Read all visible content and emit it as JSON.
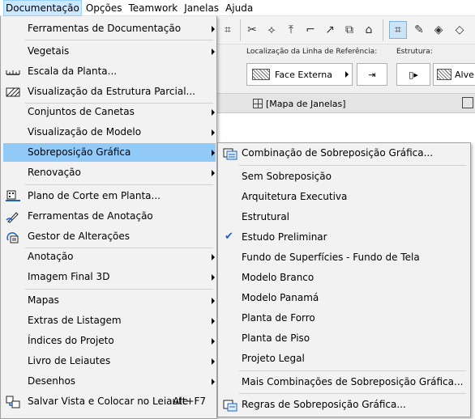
{
  "menubar": {
    "items": [
      "Documentação",
      "Opções",
      "Teamwork",
      "Janelas",
      "Ajuda"
    ]
  },
  "infobox": {
    "ref_line_label": "Localização da Linha de Referência:",
    "ref_line_value": "Face Externa",
    "structure_label": "Estrutura:",
    "structure_value": "Alve"
  },
  "tab": {
    "label": "[Mapa de Janelas]"
  },
  "main_menu": {
    "items": [
      {
        "label": "Ferramentas de Documentação",
        "submenu": true
      },
      {
        "label": "Vegetais",
        "submenu": true
      },
      {
        "label": "Escala da Planta...",
        "icon": "scale-icon"
      },
      {
        "label": "Visualização da Estrutura Parcial...",
        "icon": "partial-structure-icon"
      },
      {
        "label": "Conjuntos de Canetas",
        "submenu": true
      },
      {
        "label": "Visualização de Modelo",
        "submenu": true
      },
      {
        "label": "Sobreposição Gráfica",
        "submenu": true
      },
      {
        "label": "Renovação",
        "submenu": true
      },
      {
        "label": "Plano de Corte em Planta...",
        "icon": "floor-plan-cut-plane-icon"
      },
      {
        "label": "Ferramentas de Anotação",
        "icon": "annotation-tools-icon"
      },
      {
        "label": "Gestor de Alterações",
        "icon": "change-manager-icon"
      },
      {
        "label": "Anotação",
        "submenu": true
      },
      {
        "label": "Imagem Final 3D",
        "submenu": true
      },
      {
        "label": "Mapas",
        "submenu": true
      },
      {
        "label": "Extras de Listagem",
        "submenu": true
      },
      {
        "label": "Índices do Projeto",
        "submenu": true
      },
      {
        "label": "Livro de Leiautes",
        "submenu": true
      },
      {
        "label": "Desenhos",
        "submenu": true
      },
      {
        "label": "Salvar Vista e Colocar no Leiaute",
        "icon": "save-view-icon",
        "shortcut": "Alt+F7"
      }
    ]
  },
  "sub_menu": {
    "items": [
      {
        "label": "Combinação de Sobreposição Gráfica...",
        "icon": "overlay-combination-icon"
      },
      {
        "label": "Sem Sobreposição"
      },
      {
        "label": "Arquitetura Executiva"
      },
      {
        "label": "Estrutural"
      },
      {
        "label": "Estudo Preliminar",
        "checked": true
      },
      {
        "label": "Fundo de Superfícies - Fundo de Tela"
      },
      {
        "label": "Modelo Branco"
      },
      {
        "label": "Modelo Panamá"
      },
      {
        "label": "Planta de Forro"
      },
      {
        "label": "Planta de Piso"
      },
      {
        "label": "Projeto Legal"
      },
      {
        "label": "Mais Combinações de Sobreposição Gráfica..."
      },
      {
        "label": "Regras de Sobreposição Gráfica...",
        "icon": "overlay-rules-icon"
      }
    ]
  },
  "colors": {
    "highlight": "#91c9f7",
    "menu_bg": "#f2f2f2",
    "active_menubar": "#cce8ff",
    "check": "#1a62c4"
  }
}
